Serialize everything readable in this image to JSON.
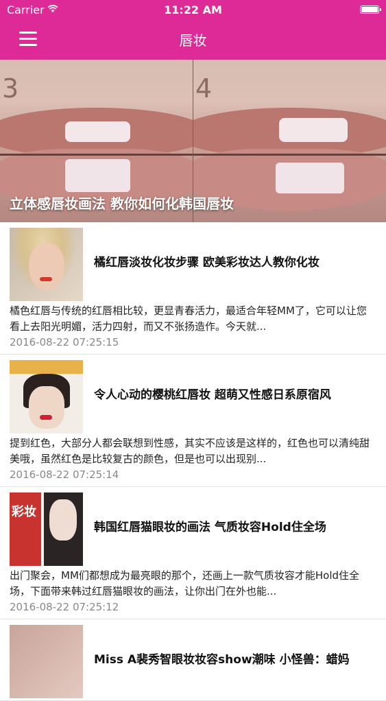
{
  "status_bar": {
    "carrier": "Carrier",
    "time": "11:22 AM"
  },
  "nav": {
    "title": "唇妆"
  },
  "hero": {
    "caption": "立体感唇妆画法 教你如何化韩国唇妆",
    "step_left": "3",
    "step_right": "4"
  },
  "articles": [
    {
      "title": "橘红唇淡妆化妆步骤 欧美彩妆达人教你化妆",
      "desc": "橘色红唇与传统的红唇相比较，更显青春活力，最适合年轻MM了，它可以让您看上去阳光明媚，活力四射，而又不张扬造作。今天就...",
      "date": "2016-08-22 07:25:15"
    },
    {
      "title": "令人心动的樱桃红唇妆 超萌又性感日系原宿风",
      "desc": "提到红色，大部分人都会联想到性感，其实不应该是这样的，红色也可以清纯甜美哦，虽然红色是比较复古的颜色，但是也可以出现别...",
      "date": "2016-08-22 07:25:14"
    },
    {
      "title": "韩国红唇猫眼妆的画法 气质妆容Hold住全场",
      "desc": "出门聚会，MM们都想成为最亮眼的那个，还画上一款气质妆容才能Hold住全场，下面带来韩过红唇猫眼妆的画法，让你出门在外也能...",
      "date": "2016-08-22 07:25:12",
      "thumb_text": "彩妆"
    },
    {
      "title": "Miss A裴秀智眼妆妆容show潮味 小怪兽：蜡妈"
    }
  ],
  "colors": {
    "accent": "#de2a96"
  }
}
